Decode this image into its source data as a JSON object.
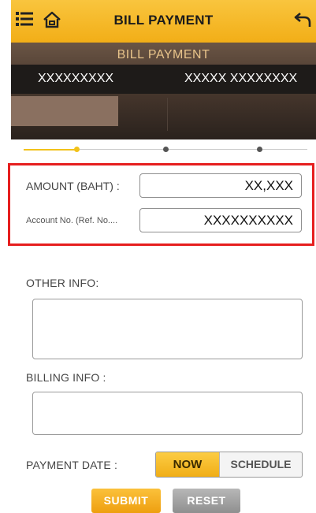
{
  "header": {
    "title": "BILL PAYMENT",
    "icons": [
      "menu-icon",
      "home-icon",
      "back-icon"
    ],
    "accent": "#f2ae17"
  },
  "banner": {
    "title": "BILL PAYMENT",
    "left_text": "XXXXXXXXX",
    "right_text": "XXXXX XXXXXXXX"
  },
  "stepper": {
    "steps": 3,
    "current_step": 1,
    "active_color": "#f2c21a"
  },
  "form": {
    "amount_label": "AMOUNT (BAHT) :",
    "amount_value": "XX,XXX",
    "account_label": "Account No. (Ref. No....",
    "account_value": "XXXXXXXXXX",
    "highlight_color": "#e61e1e"
  },
  "other_info": {
    "label": "OTHER INFO:",
    "value": ""
  },
  "billing_info": {
    "label": "BILLING INFO :",
    "value": ""
  },
  "payment_date": {
    "label": "PAYMENT DATE :",
    "options": [
      "NOW",
      "SCHEDULE"
    ],
    "selected": "NOW"
  },
  "actions": {
    "submit_label": "SUBMIT",
    "reset_label": "RESET"
  }
}
